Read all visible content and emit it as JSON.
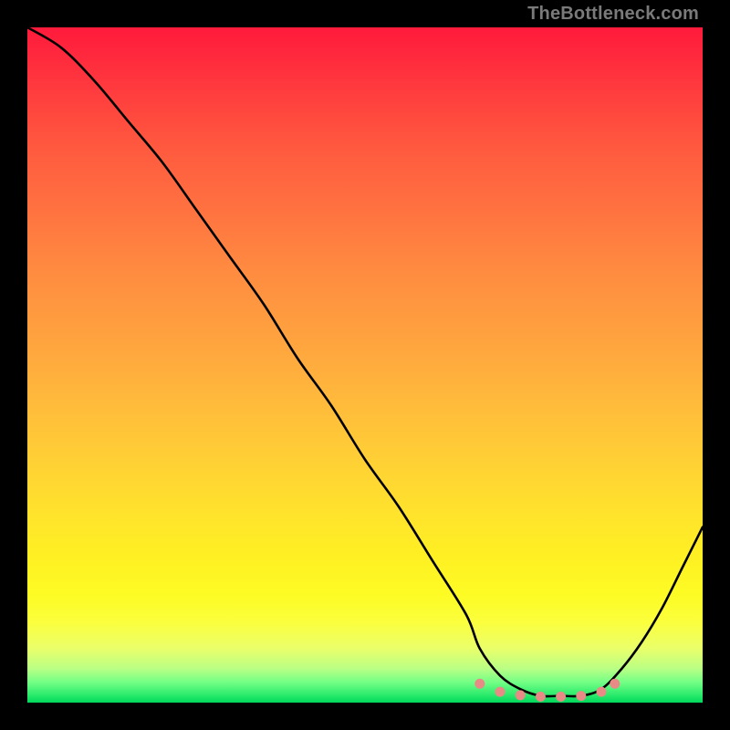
{
  "watermark": "TheBottleneck.com",
  "chart_data": {
    "type": "line",
    "title": "",
    "xlabel": "",
    "ylabel": "",
    "xlim": [
      0,
      100
    ],
    "ylim": [
      0,
      100
    ],
    "x": [
      0,
      5,
      10,
      15,
      20,
      25,
      30,
      35,
      40,
      45,
      50,
      55,
      60,
      65,
      67,
      70,
      73,
      76,
      79,
      82,
      85,
      88,
      91,
      94,
      97,
      100
    ],
    "values": [
      100,
      97,
      92,
      86,
      80,
      73,
      66,
      59,
      51,
      44,
      36,
      29,
      21,
      13,
      8,
      4,
      2,
      1,
      1,
      1,
      2,
      5,
      9,
      14,
      20,
      26
    ],
    "marker_points_x": [
      67,
      70,
      73,
      76,
      79,
      82,
      85,
      87
    ],
    "marker_points_y": [
      2.8,
      1.6,
      1.1,
      0.9,
      0.9,
      1.0,
      1.6,
      2.8
    ],
    "marker_color": "#e88a86",
    "background_gradient": {
      "top_color": "#ff1a3c",
      "mid_colors": [
        "#ff7240",
        "#ffcd36",
        "#fdfb24"
      ],
      "bottom_color": "#00d85c"
    }
  }
}
